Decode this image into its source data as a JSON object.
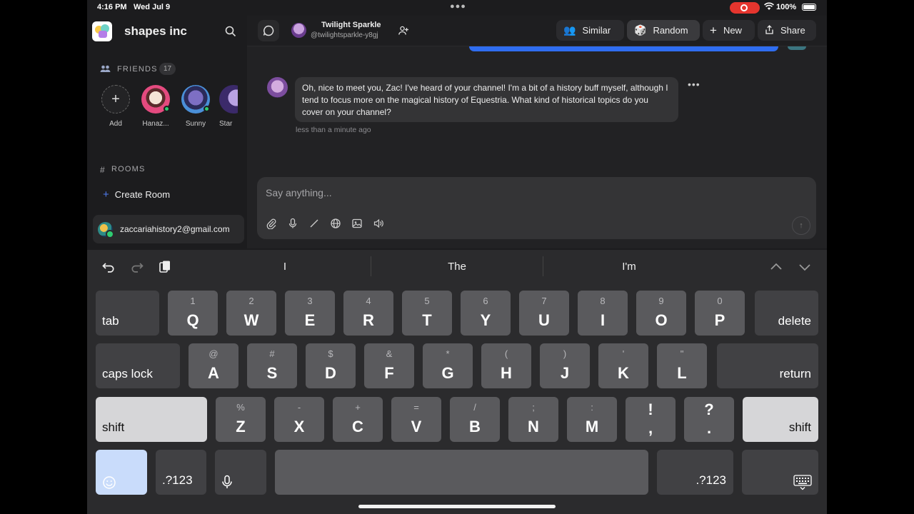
{
  "status": {
    "time": "4:16 PM",
    "date": "Wed Jul 9",
    "battery": "100%"
  },
  "sidebar": {
    "brand": "shapes inc",
    "friends_label": "FRIENDS",
    "friends_count": "17",
    "friends": [
      {
        "name": "Add"
      },
      {
        "name": "Hanaz..."
      },
      {
        "name": "Sunny"
      },
      {
        "name": "Star"
      }
    ],
    "rooms_label": "ROOMS",
    "create_room": "Create Room",
    "account_email": "zaccariahistory2@gmail.com"
  },
  "topbar": {
    "name": "Twilight Sparkle",
    "handle": "@twilightsparkle-y8gj",
    "similar": "Similar",
    "random": "Random",
    "new": "New",
    "share": "Share"
  },
  "chat": {
    "message": "Oh, nice to meet you, Zac! I've heard of your channel! I'm a bit of a history buff myself, although I tend to focus more on the magical history of Equestria. What kind of historical topics do you cover on your channel?",
    "time": "less than a minute ago",
    "input_placeholder": "Say anything..."
  },
  "keyboard": {
    "suggestions": [
      "I",
      "The",
      "I'm"
    ],
    "row1": [
      {
        "hint": "1",
        "key": "Q"
      },
      {
        "hint": "2",
        "key": "W"
      },
      {
        "hint": "3",
        "key": "E"
      },
      {
        "hint": "4",
        "key": "R"
      },
      {
        "hint": "5",
        "key": "T"
      },
      {
        "hint": "6",
        "key": "Y"
      },
      {
        "hint": "7",
        "key": "U"
      },
      {
        "hint": "8",
        "key": "I"
      },
      {
        "hint": "9",
        "key": "O"
      },
      {
        "hint": "0",
        "key": "P"
      }
    ],
    "row2": [
      {
        "hint": "@",
        "key": "A"
      },
      {
        "hint": "#",
        "key": "S"
      },
      {
        "hint": "$",
        "key": "D"
      },
      {
        "hint": "&",
        "key": "F"
      },
      {
        "hint": "*",
        "key": "G"
      },
      {
        "hint": "(",
        "key": "H"
      },
      {
        "hint": ")",
        "key": "J"
      },
      {
        "hint": "'",
        "key": "K"
      },
      {
        "hint": "\"",
        "key": "L"
      }
    ],
    "row3": [
      {
        "hint": "%",
        "key": "Z"
      },
      {
        "hint": "-",
        "key": "X"
      },
      {
        "hint": "+",
        "key": "C"
      },
      {
        "hint": "=",
        "key": "V"
      },
      {
        "hint": "/",
        "key": "B"
      },
      {
        "hint": ";",
        "key": "N"
      },
      {
        "hint": ":",
        "key": "M"
      },
      {
        "hint": "!",
        "key": ","
      },
      {
        "hint": "?",
        "key": "."
      }
    ],
    "tab": "tab",
    "delete": "delete",
    "caps_lock": "caps lock",
    "return": "return",
    "shift": "shift",
    "num": ".?123"
  }
}
